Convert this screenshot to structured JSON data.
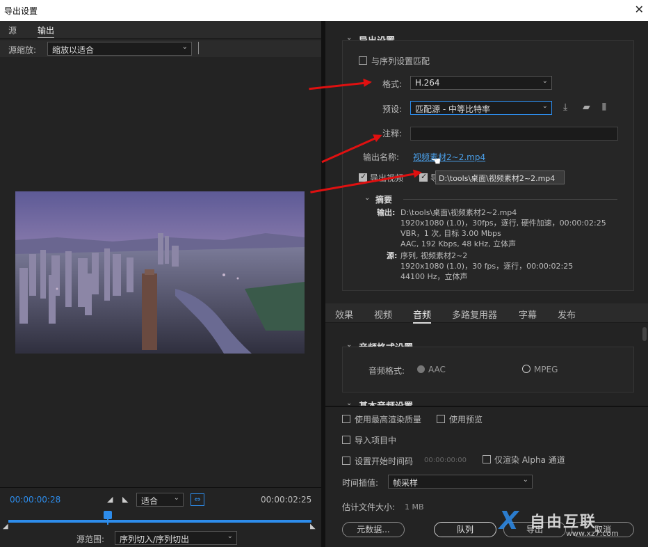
{
  "window": {
    "title": "导出设置",
    "close": "✕"
  },
  "left": {
    "tabs": [
      "源",
      "输出"
    ],
    "scale_label": "源缩放:",
    "scale_value": "缩放以适合",
    "tc_start": "00:00:00:28",
    "fit_value": "适合",
    "tc_end": "00:00:02:25",
    "range_label": "源范围:",
    "range_value": "序列切入/序列切出"
  },
  "export": {
    "section_title": "导出设置",
    "match_seq": "与序列设置匹配",
    "format_label": "格式:",
    "format_value": "H.264",
    "preset_label": "预设:",
    "preset_value": "匹配源 - 中等比特率",
    "comment_label": "注释:",
    "outname_label": "输出名称:",
    "outname_value": "视频素材2~2.mp4",
    "export_video": "导出视频",
    "export_audio_partial": "导",
    "tooltip": "D:\\tools\\桌面\\视频素材2~2.mp4",
    "summary_title": "摘要",
    "out_label": "输出:",
    "out_lines": [
      "D:\\tools\\桌面\\视频素材2~2.mp4",
      "1920x1080 (1.0)，30fps，逐行, 硬件加速，00:00:02:25",
      "VBR，1 次, 目标 3.00 Mbps",
      "AAC, 192 Kbps, 48  kHz, 立体声"
    ],
    "src_label": "源:",
    "src_lines": [
      "序列, 视频素材2~2",
      "1920x1080 (1.0)，30 fps，逐行，00:00:02:25",
      "44100 Hz，立体声"
    ]
  },
  "tabs2": [
    "效果",
    "视频",
    "音频",
    "多路复用器",
    "字幕",
    "发布"
  ],
  "audio": {
    "section_title": "音频格式设置",
    "format_label": "音频格式:",
    "opt1": "AAC",
    "opt2": "MPEG",
    "basic_title": "基本音频设置"
  },
  "bottom": {
    "max_quality": "使用最高渲染质量",
    "use_preview": "使用预览",
    "import_project": "导入项目中",
    "set_start_tc": "设置开始时间码",
    "start_tc": "00:00:00:00",
    "alpha_only": "仅渲染 Alpha 通道",
    "interp_label": "时间插值:",
    "interp_value": "帧采样",
    "filesize_label": "估计文件大小:",
    "filesize_value": "1 MB",
    "metadata_btn": "元数据...",
    "queue_btn": "队列",
    "export_btn": "导出",
    "cancel_btn": "取消"
  },
  "watermark": {
    "text": "自由互联",
    "url": "www.xz7.com"
  },
  "colors": {
    "accent": "#2d8ceb",
    "arrow": "#e01010",
    "link": "#4a9fe8"
  }
}
